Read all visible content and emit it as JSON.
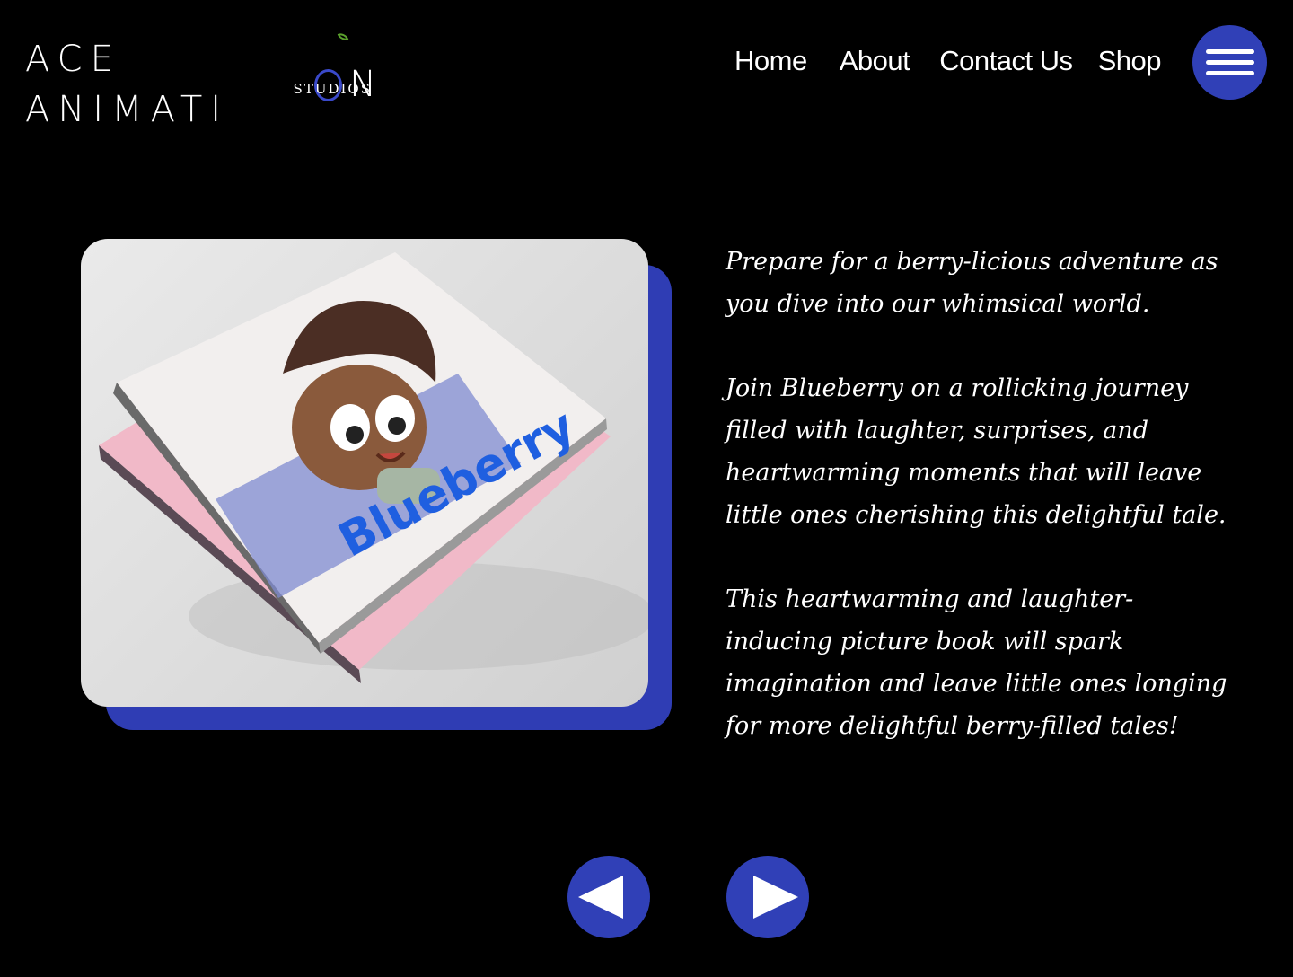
{
  "brand": {
    "logo_text_before": "ACE ANIMATI",
    "logo_text_after": "N",
    "logo_sub": "STUDIOS",
    "accent": "#3040b7",
    "leaf": "#5aa02c"
  },
  "nav": {
    "items": [
      {
        "label": "Home"
      },
      {
        "label": "About"
      },
      {
        "label": "Contact Us"
      },
      {
        "label": "Shop"
      }
    ],
    "menu_icon": "hamburger-icon"
  },
  "feature": {
    "book_title": "Blueberry",
    "paragraphs": [
      "Prepare for a berry-licious adventure as you dive into our whimsical world.",
      "Join Blueberry on a rollicking journey filled with laughter, surprises, and heartwarming moments that will leave little ones cherishing this delightful tale.",
      "This heartwarming and laughter-inducing picture book will spark imagination and leave little ones longing for more delightful berry-filled tales!"
    ]
  },
  "carousel": {
    "prev_icon": "triangle-left-icon",
    "next_icon": "triangle-right-icon"
  }
}
